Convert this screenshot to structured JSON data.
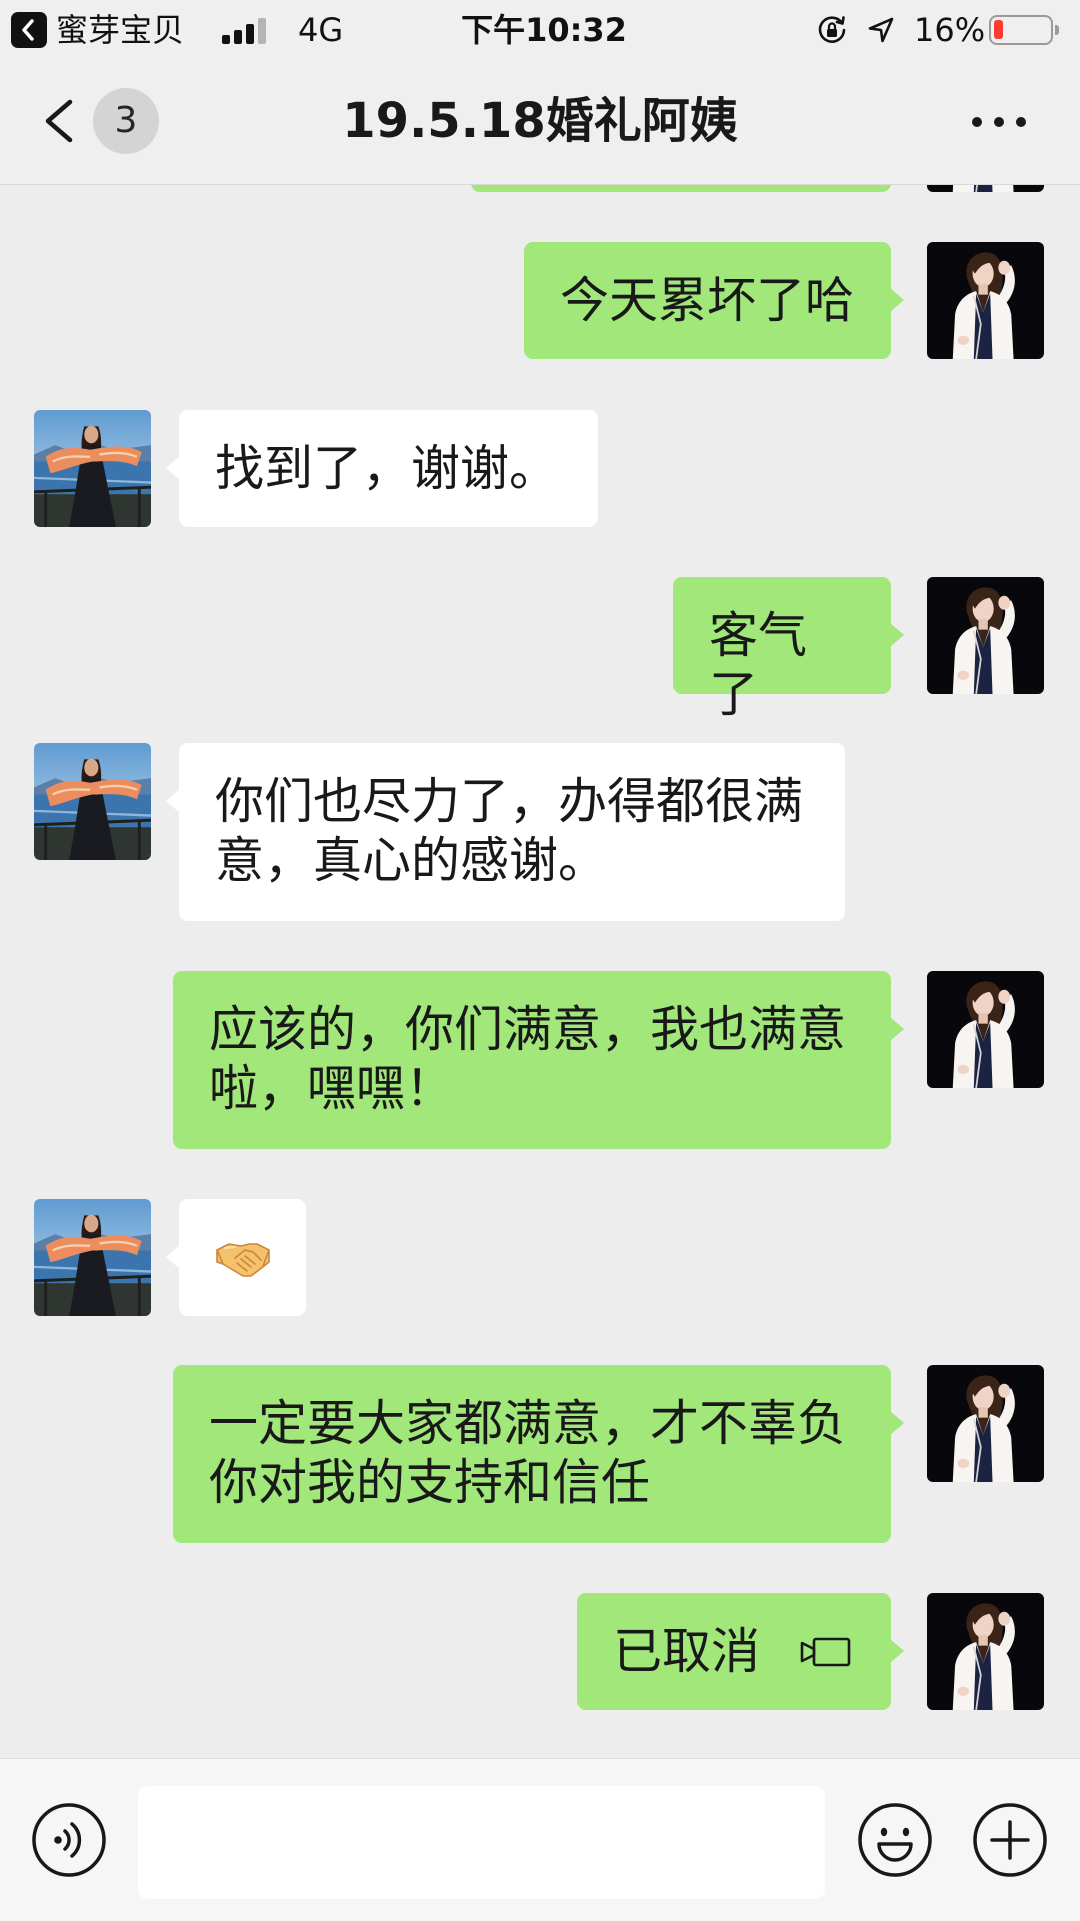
{
  "status_bar": {
    "back_app_icon": "back-to-app-icon",
    "back_app_label": "蜜芽宝贝",
    "signal_strength": 3,
    "signal_max": 4,
    "network": "4G",
    "time": "下午10:32",
    "orientation_lock_icon": "orientation-lock-icon",
    "location_icon": "location-arrow-icon",
    "battery_label": "16%",
    "battery_level": 0.16,
    "battery_color": "#ff3b30"
  },
  "nav": {
    "back_icon": "chevron-left-icon",
    "unread_count": "3",
    "title": "19.5.18婚礼阿姨",
    "more_icon": "more-dots-icon"
  },
  "colors": {
    "chat_background": "#ededed",
    "header_background": "#efefef",
    "outgoing_bubble": "#a2e77a",
    "incoming_bubble": "#ffffff",
    "text": "#191919"
  },
  "messages": [
    {
      "is_outgoing": true,
      "partially_visible": true,
      "avatar_icon": "self-avatar"
    },
    {
      "is_outgoing": true,
      "text": "今天累坏了哈",
      "avatar_icon": "self-avatar"
    },
    {
      "is_outgoing": false,
      "text": "找到了，谢谢。",
      "avatar_icon": "contact-avatar"
    },
    {
      "is_outgoing": true,
      "text": "客气了",
      "avatar_icon": "self-avatar"
    },
    {
      "is_outgoing": false,
      "text": "你们也尽力了，办得都很满意，真心的感谢。",
      "avatar_icon": "contact-avatar"
    },
    {
      "is_outgoing": true,
      "text": "应该的，你们满意，我也满意啦，嘿嘿！",
      "avatar_icon": "self-avatar"
    },
    {
      "is_outgoing": false,
      "emoji_icon": "handshake-emoji",
      "avatar_icon": "contact-avatar"
    },
    {
      "is_outgoing": true,
      "text": "一定要大家都满意，才不辜负你对我的支持和信任",
      "avatar_icon": "self-avatar"
    },
    {
      "is_outgoing": true,
      "text": "已取消",
      "call_icon": "video-call-icon",
      "avatar_icon": "self-avatar"
    }
  ],
  "input_bar": {
    "voice_icon": "voice-input-icon",
    "text_value": "",
    "emoji_icon": "emoji-icon",
    "more_icon": "plus-icon"
  }
}
